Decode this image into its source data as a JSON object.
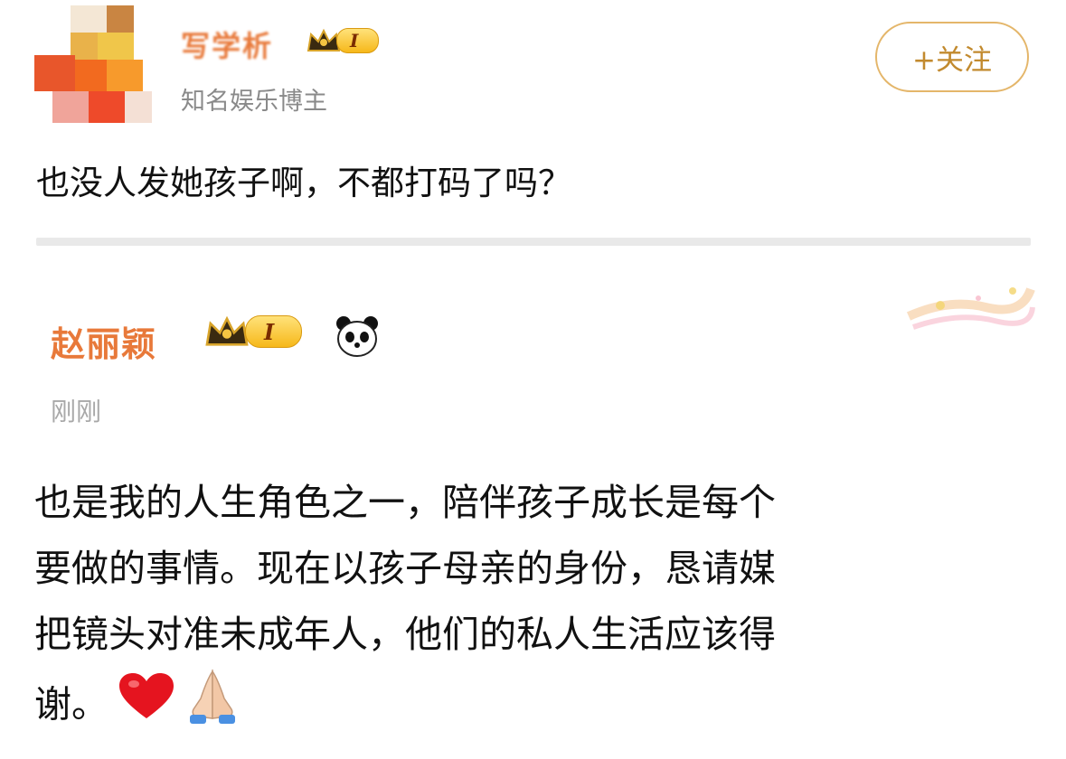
{
  "post": {
    "author_name": "写学析",
    "level": "I",
    "author_desc": "知名娱乐博主",
    "follow_label": "+关注",
    "text": "也没人发她孩子啊，不都打码了吗？"
  },
  "reply": {
    "author_name": "赵丽颖",
    "level": "I",
    "time": "刚刚",
    "lines": [
      "也是我的人生角色之一，陪伴孩子成长是每个",
      "要做的事情。现在以孩子母亲的身份，恳请媒",
      "把镜头对准未成年人，他们的私人生活应该得",
      "谢。"
    ],
    "emojis": [
      "red-heart-icon",
      "praying-hands-icon"
    ]
  },
  "colors": {
    "name_orange": "#e8793a",
    "follow_gold": "#c28a2e",
    "meta_gray": "#8a8a8a"
  }
}
